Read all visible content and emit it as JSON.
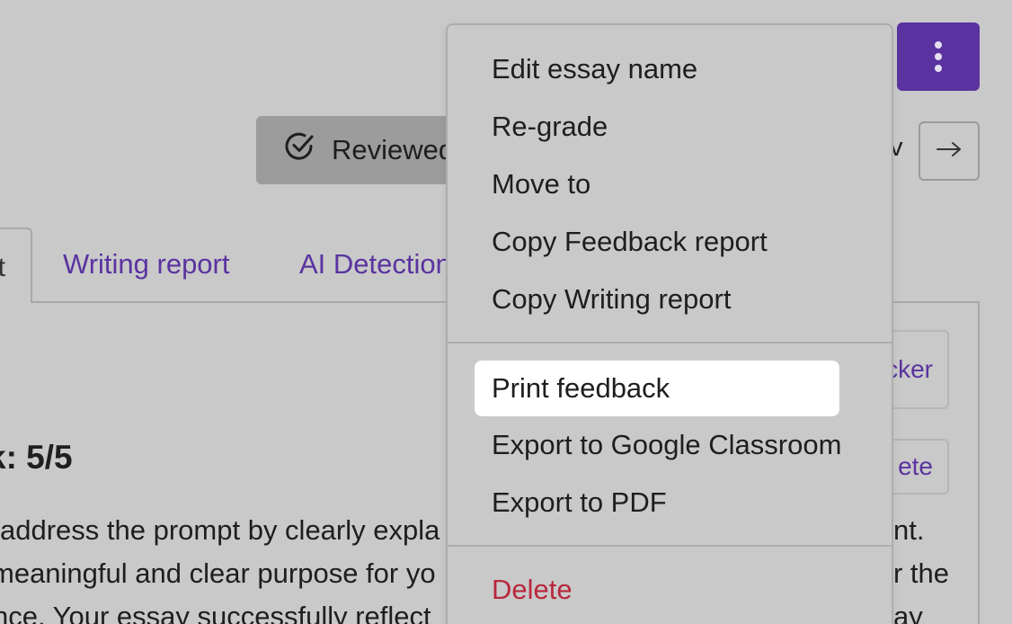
{
  "header": {
    "more_icon": "vertical-ellipsis-icon",
    "reviewed_label": "Reviewed",
    "reviewed_icon": "check-circle-icon",
    "peek_text": "v",
    "next_icon": "arrow-right-icon"
  },
  "tabs": {
    "active_partial": "t",
    "writing_report": "Writing report",
    "ai_detection": "AI Detection"
  },
  "side_buttons": {
    "checker": "cker",
    "delete": "ete"
  },
  "feedback": {
    "score_text": "k: 5/5",
    "line1_left": "address the prompt by clearly expla",
    "line2_left": "meaningful and clear purpose for yo",
    "line3_left": "nce. Your essay successfully reflect",
    "line1_right": "nt.",
    "line2_right": "r the",
    "line3_right": "ay"
  },
  "menu": {
    "items": [
      {
        "label": "Edit essay name"
      },
      {
        "label": "Re-grade"
      },
      {
        "label": "Move to"
      },
      {
        "label": "Copy Feedback report"
      },
      {
        "label": "Copy Writing report"
      },
      {
        "label": "Print feedback"
      },
      {
        "label": "Export to Google Classroom"
      },
      {
        "label": "Export to PDF"
      },
      {
        "label": "Delete"
      }
    ]
  },
  "colors": {
    "accent": "#5a33a0",
    "danger": "#b8283d",
    "overlay_bg": "#c9c9c9",
    "highlight": "#ffffff"
  }
}
